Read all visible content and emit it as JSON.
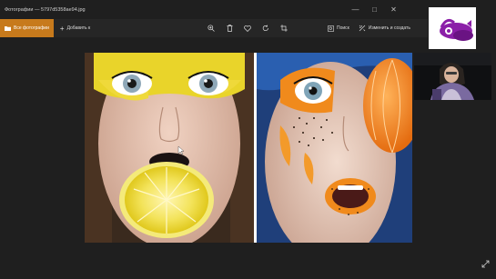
{
  "window": {
    "title": "Фотографии — 5797d5358ae94.jpg",
    "minimize_icon": "minimize-icon",
    "maximize_icon": "maximize-icon",
    "close_icon": "close-icon"
  },
  "toolbar": {
    "all_photos_label": "Все фотографии",
    "add_label": "Добавить к",
    "search_label": "Поиск",
    "edit_create_label": "Изменить и создать",
    "icons": [
      "zoom-in-icon",
      "delete-icon",
      "heart-icon",
      "rotate-icon",
      "crop-icon"
    ]
  },
  "colors": {
    "accent": "#c77a1c",
    "background": "#1f1f1f",
    "logo_purple": "#8b1fa8"
  }
}
